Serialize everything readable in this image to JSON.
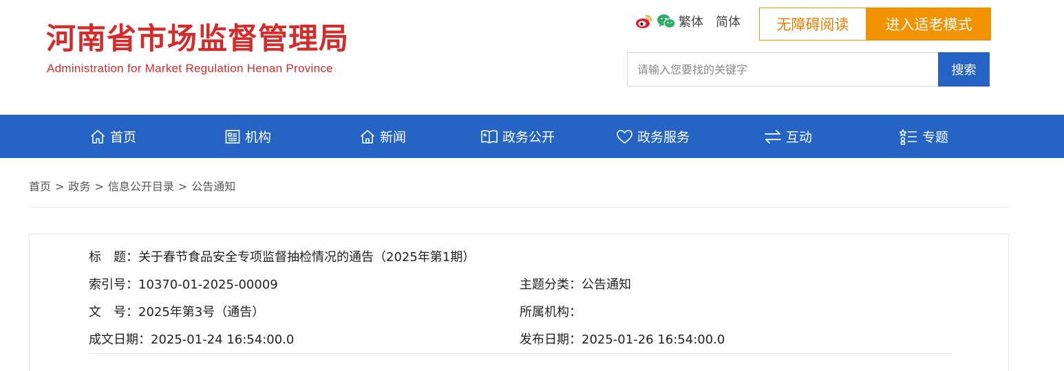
{
  "header": {
    "logo_cn": "河南省市场监督管理局",
    "logo_en": "Administration for Market Regulation Henan Province",
    "social_icons": [
      "weibo-icon",
      "wechat-icon"
    ],
    "lang_traditional": "繁体",
    "lang_simplified": "简体",
    "accessible_reading": "无障碍阅读",
    "elder_mode": "进入适老模式",
    "search_placeholder": "请输入您要找的关键字",
    "search_button": "搜索"
  },
  "colors": {
    "brand_red": "#d42b2b",
    "nav_blue": "#2563c4",
    "accent_orange": "#f39200"
  },
  "nav": {
    "items": [
      {
        "label": "首页",
        "icon": "home-icon"
      },
      {
        "label": "机构",
        "icon": "organization-icon"
      },
      {
        "label": "新闻",
        "icon": "news-icon"
      },
      {
        "label": "政务公开",
        "icon": "open-book-icon"
      },
      {
        "label": "政务服务",
        "icon": "heart-icon"
      },
      {
        "label": "互动",
        "icon": "exchange-arrows-icon"
      },
      {
        "label": "专题",
        "icon": "topic-list-icon"
      }
    ]
  },
  "breadcrumb": {
    "items": [
      "首页",
      "政务",
      "信息公开目录",
      "公告通知"
    ],
    "separator": ">"
  },
  "info": {
    "title_label": "标　题：",
    "title_value": "关于春节食品安全专项监督抽检情况的通告（2025年第1期）",
    "index_label": "索引号：",
    "index_value": "10370-01-2025-00009",
    "category_label": "主题分类：",
    "category_value": "公告通知",
    "doc_no_label": "文　号：",
    "doc_no_value": "2025年第3号（通告）",
    "org_label": "所属机构：",
    "org_value": "",
    "created_label": "成文日期：",
    "created_value": "2025-01-24 16:54:00.0",
    "published_label": "发布日期：",
    "published_value": "2025-01-26 16:54:00.0"
  }
}
